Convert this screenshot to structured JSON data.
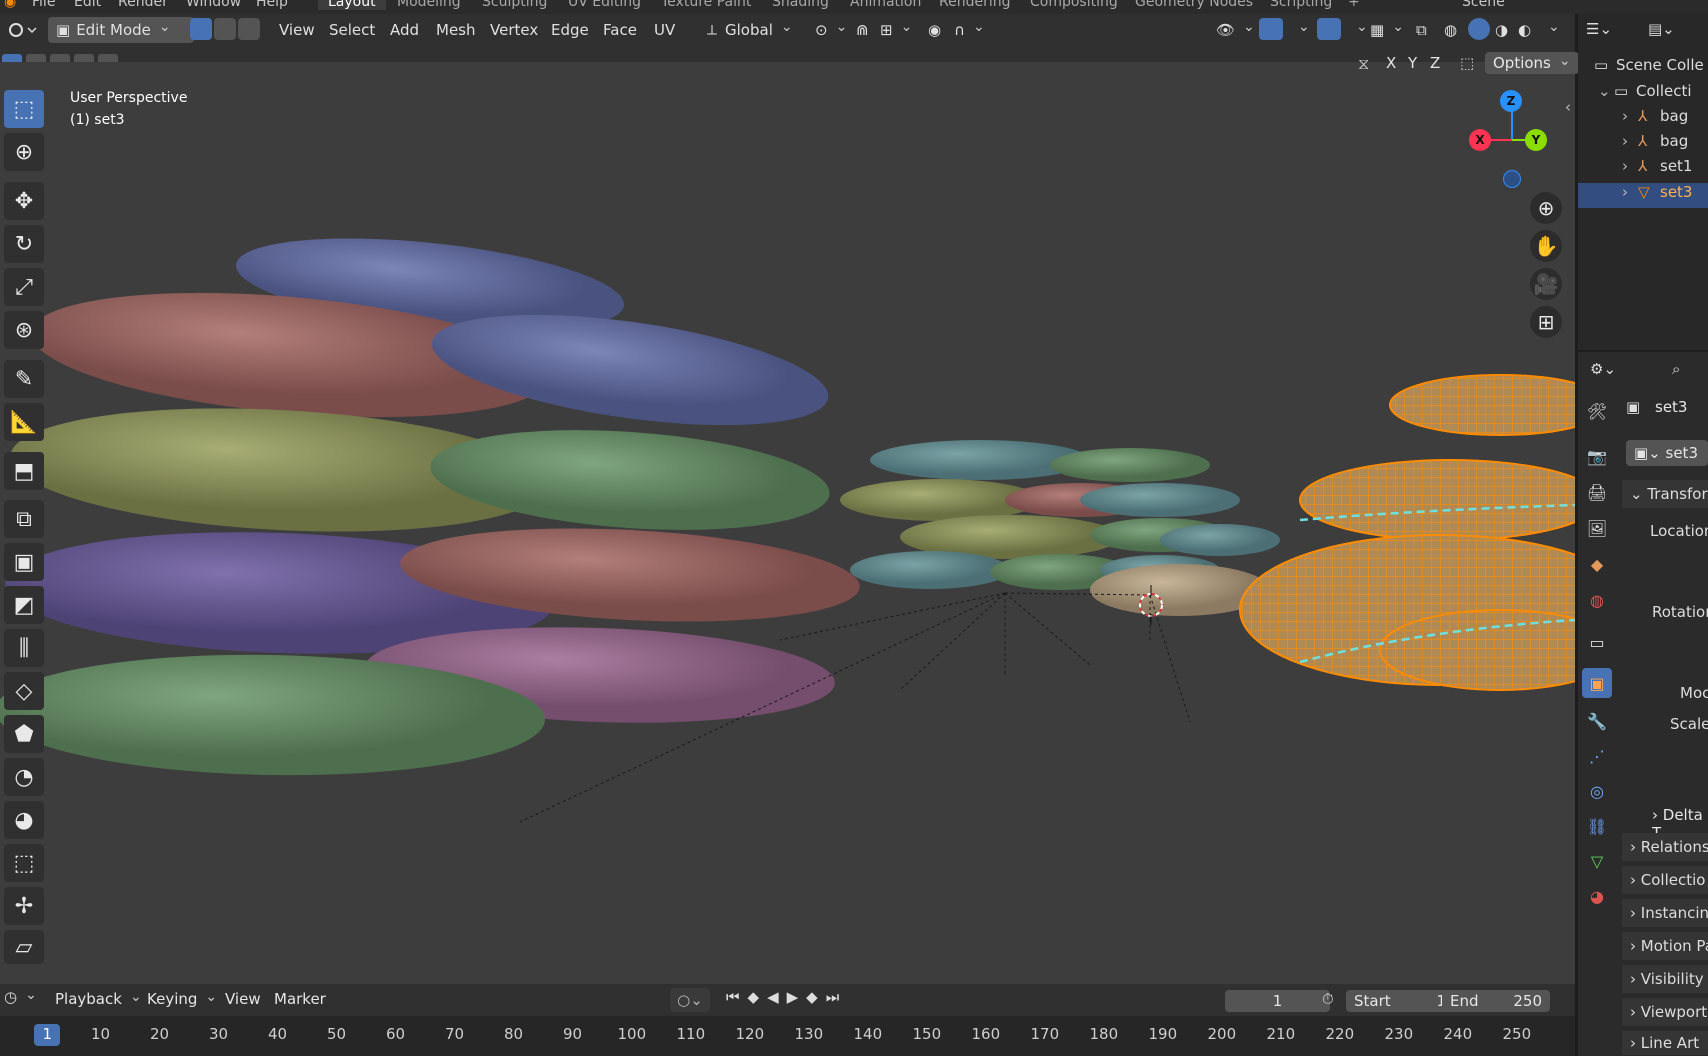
{
  "menu": {
    "items": [
      "File",
      "Edit",
      "Render",
      "Window",
      "Help"
    ],
    "workspaces": [
      "Layout",
      "Modeling",
      "Sculpting",
      "UV Editing",
      "Texture Paint",
      "Shading",
      "Animation",
      "Rendering",
      "Compositing",
      "Geometry Nodes",
      "Scripting"
    ],
    "active_workspace": "Layout",
    "scene_name": "Scene"
  },
  "header": {
    "mode": "Edit Mode",
    "menus": [
      "View",
      "Select",
      "Add",
      "Mesh",
      "Vertex",
      "Edge",
      "Face",
      "UV"
    ],
    "transform_orientation": "Global",
    "axis_buttons": [
      "X",
      "Y",
      "Z"
    ],
    "options_label": "Options"
  },
  "viewport": {
    "view_name": "User Perspective",
    "object_info": "(1) set3",
    "gizmo_axes": [
      "Z",
      "X",
      "Y"
    ]
  },
  "outliner": {
    "rows": [
      {
        "label": "Scene Colle",
        "icon": "scene-collection-icon"
      },
      {
        "label": "Collecti",
        "icon": "collection-icon"
      },
      {
        "label": "bag",
        "icon": "armature-icon"
      },
      {
        "label": "bag",
        "icon": "armature-icon"
      },
      {
        "label": "set1",
        "icon": "armature-icon"
      },
      {
        "label": "set3",
        "icon": "mesh-icon",
        "selected": true
      }
    ]
  },
  "properties": {
    "object_name": "set3",
    "datablock_name": "set3",
    "sections": [
      "Transform",
      "Delta T",
      "Relations",
      "Collectio",
      "Instancin",
      "Motion Pa",
      "Visibility",
      "Viewport",
      "Line Art"
    ],
    "fields": [
      "Location",
      "Rotation",
      "Moc",
      "Scale"
    ]
  },
  "timeline": {
    "menus": [
      "Playback",
      "Keying",
      "View",
      "Marker"
    ],
    "current_frame": "1",
    "start_label": "Start",
    "start_value": "1",
    "end_label": "End",
    "end_value": "250",
    "ticks": [
      "1",
      "10",
      "20",
      "30",
      "40",
      "50",
      "60",
      "70",
      "80",
      "90",
      "100",
      "110",
      "120",
      "130",
      "140",
      "150",
      "160",
      "170",
      "180",
      "190",
      "200",
      "210",
      "220",
      "230",
      "240",
      "250"
    ]
  },
  "colors": {
    "accent": "#4772b3",
    "selection_orange": "#ff8c00",
    "viewport_bg": "#3d3d3d",
    "axis_x": "#ff3352",
    "axis_y": "#8bdc00",
    "axis_z": "#2890ff"
  }
}
